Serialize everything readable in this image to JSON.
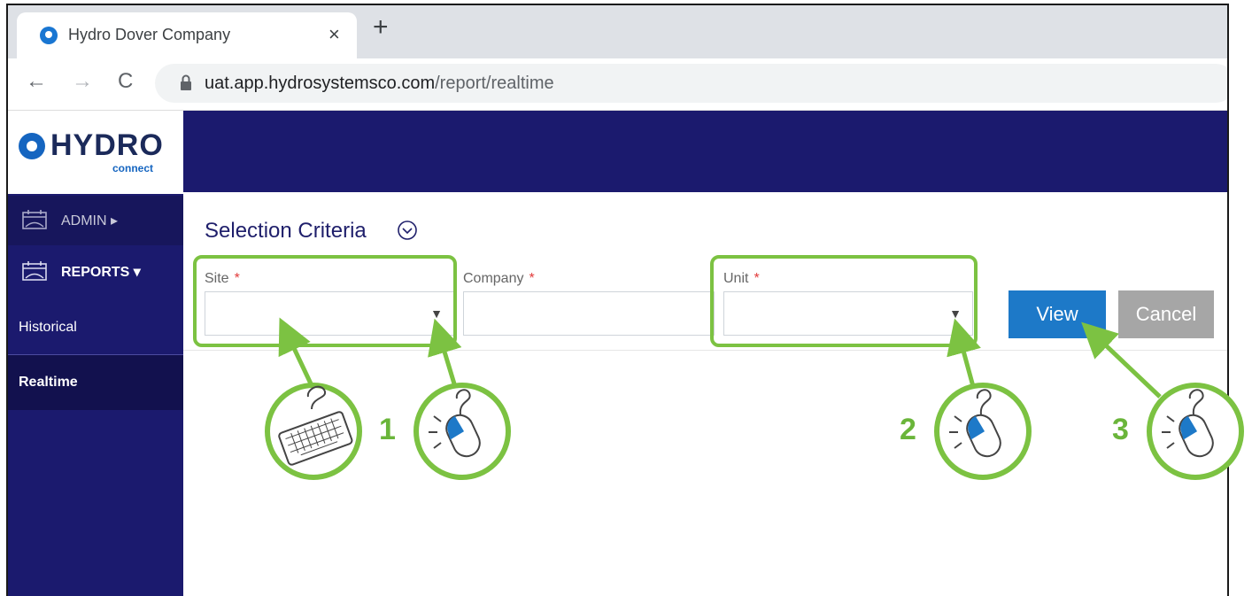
{
  "browser": {
    "tab_title": "Hydro Dover Company",
    "close_glyph": "×",
    "new_tab_glyph": "+",
    "back_glyph": "←",
    "forward_glyph": "→",
    "reload_glyph": "C",
    "url_host": "uat.app.hydrosystemsco.com",
    "url_path": "/report/realtime"
  },
  "logo": {
    "text": "HYDRO",
    "sub": "connect"
  },
  "sidebar": {
    "items": [
      {
        "label": "ADMIN ▸",
        "icon": "calendar-icon"
      },
      {
        "label": "REPORTS ▾",
        "icon": "calendar-icon"
      },
      {
        "label": "Historical"
      },
      {
        "label": "Realtime"
      }
    ]
  },
  "selection": {
    "title": "Selection Criteria",
    "fields": [
      {
        "label": "Site",
        "required": "*",
        "value": "",
        "dropdown_glyph": "▼"
      },
      {
        "label": "Company",
        "required": "*",
        "value": ""
      },
      {
        "label": "Unit",
        "required": "*",
        "value": "",
        "dropdown_glyph": "▼"
      }
    ],
    "view_label": "View",
    "cancel_label": "Cancel"
  },
  "annotations": {
    "steps": [
      "1",
      "2",
      "3"
    ],
    "icons": [
      "keyboard-icon",
      "mouse-click-icon",
      "mouse-click-icon",
      "mouse-click-icon"
    ],
    "color": "#7cc242"
  },
  "colors": {
    "nav_bg": "#1b1a6e",
    "view_button": "#1d79c8",
    "cancel_button": "#a6a6a6",
    "required": "#e23b3b"
  }
}
